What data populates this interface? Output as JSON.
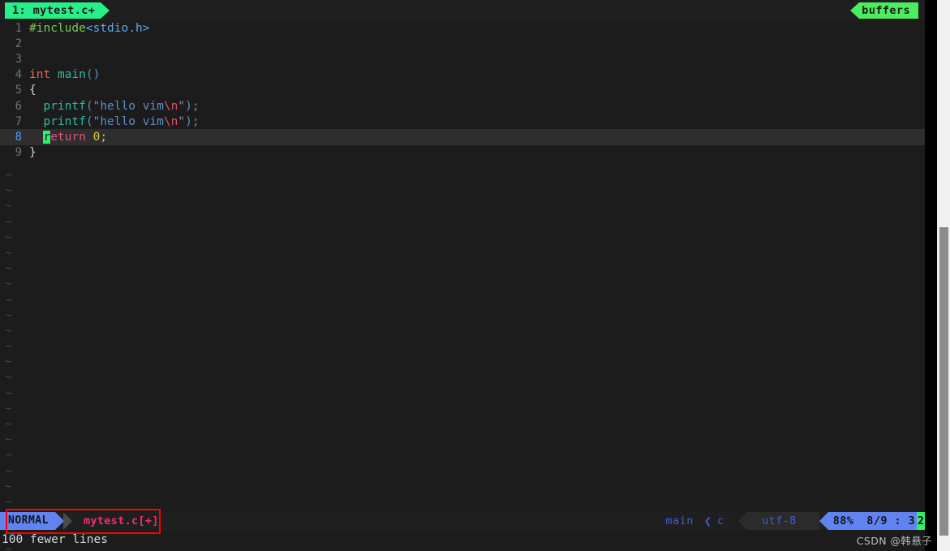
{
  "tabline": {
    "left_tab": "1: mytest.c+",
    "right_tab": "buffers",
    "left_tab_color": "#27f08a",
    "right_tab_color": "#4bef5e"
  },
  "editor": {
    "cursor_line": 8,
    "cursor_char": "r",
    "lines": [
      {
        "num": "1",
        "text": "#include<stdio.h>"
      },
      {
        "num": "2",
        "text": ""
      },
      {
        "num": "3",
        "text": ""
      },
      {
        "num": "4",
        "text": "int main()"
      },
      {
        "num": "5",
        "text": "{"
      },
      {
        "num": "6",
        "text": "  printf(\"hello vim\\n\");"
      },
      {
        "num": "7",
        "text": "  printf(\"hello vim\\n\");"
      },
      {
        "num": "8",
        "text": "  return 0;"
      },
      {
        "num": "9",
        "text": "}"
      }
    ],
    "tokens": {
      "include_directive": "#include",
      "include_header": "<stdio.h>",
      "type_int": "int",
      "fn_main": "main",
      "paren_open": "(",
      "paren_close": ")",
      "brace_open": "{",
      "brace_close": "}",
      "fn_printf": "printf",
      "string_body": "hello vim",
      "escape_seq": "\\n",
      "quote": "\"",
      "semicolon": ";",
      "kw_return": "return",
      "num_zero": "0",
      "cursor_rest": "eturn",
      "indent": "  "
    },
    "tilde_char": "~",
    "tilde_count": 25
  },
  "statusline": {
    "mode": "NORMAL",
    "filename": "mytest.c[+]",
    "branch": "main",
    "branch_separator": "❮",
    "filetype": "c",
    "encoding": "utf-8",
    "percent": "88%",
    "position": "8/9 :  3",
    "cursor_col": "2",
    "mode_color": "#6183f0",
    "filename_color": "#ef2f6e"
  },
  "cmdline": {
    "message": "100 fewer lines"
  },
  "annotation": {
    "box_color": "#ff0000"
  },
  "watermark": {
    "text": "CSDN @韩悬子"
  },
  "scrollbar": {
    "track_color": "#f0f0f0",
    "thumb_color": "#8c8c8c"
  }
}
